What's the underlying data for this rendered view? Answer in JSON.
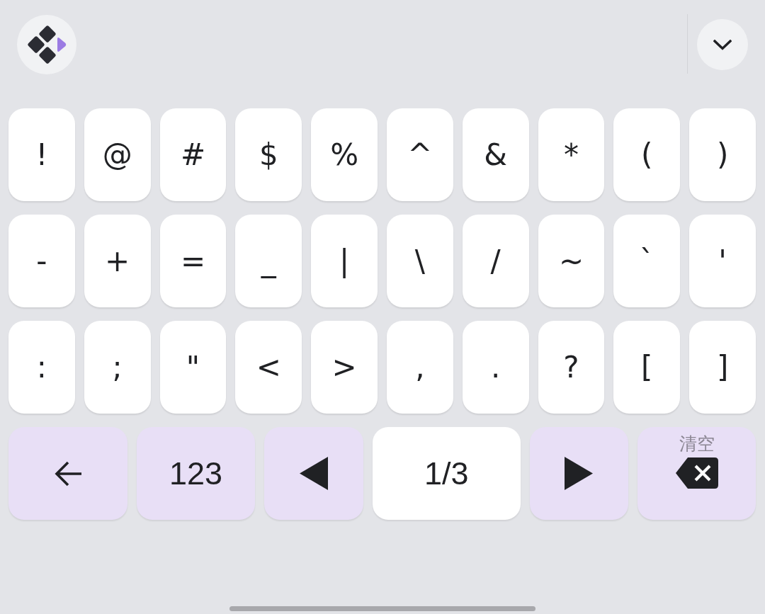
{
  "symbol_rows": [
    [
      "!",
      "@",
      "#",
      "$",
      "%",
      "^",
      "&",
      "*",
      "(",
      ")"
    ],
    [
      "-",
      "+",
      "=",
      "_",
      "|",
      "\\",
      "/",
      "~",
      "`",
      "'"
    ],
    [
      ":",
      ";",
      "\"",
      "<",
      ">",
      ",",
      ".",
      "?",
      "[",
      "]"
    ]
  ],
  "function_keys": [
    {
      "kind": "back"
    },
    {
      "kind": "mode",
      "label": "123"
    },
    {
      "kind": "prev"
    },
    {
      "kind": "page",
      "label": "1/3"
    },
    {
      "kind": "next"
    },
    {
      "kind": "clear",
      "label": "清空"
    }
  ]
}
